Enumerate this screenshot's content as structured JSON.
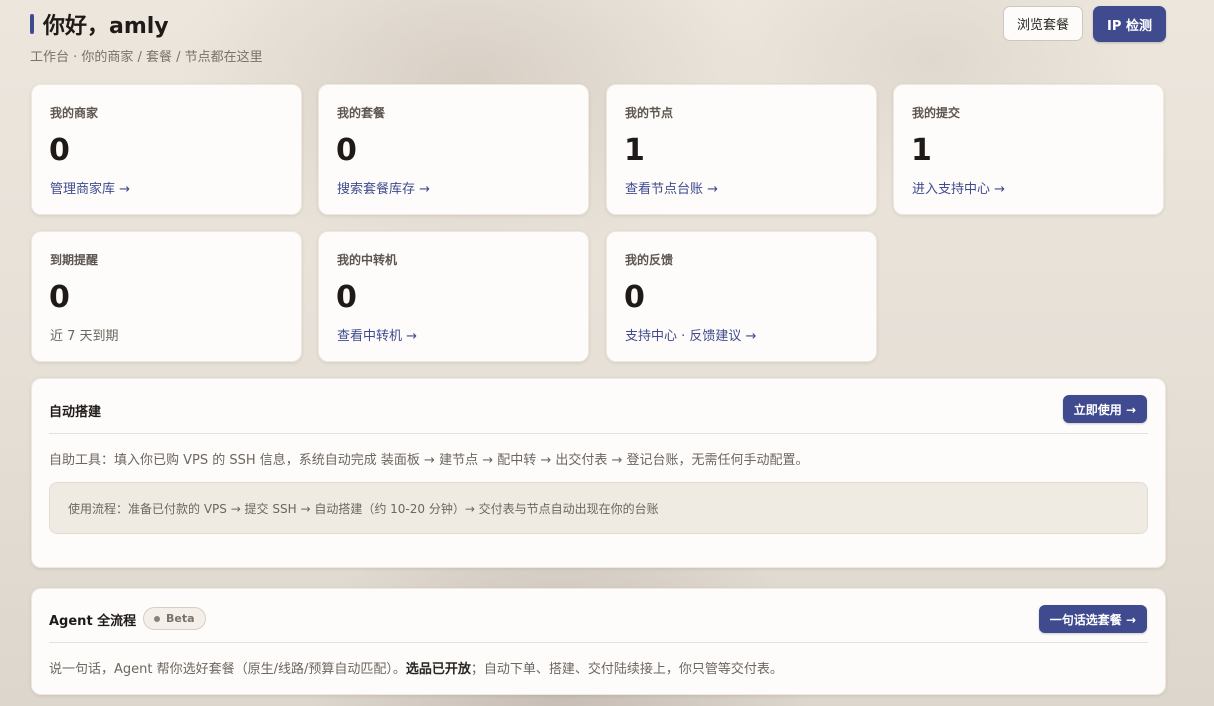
{
  "header": {
    "title": "你好，amly",
    "subtitle": "工作台 · 你的商家 / 套餐 / 节点都在这里",
    "browse_plans_label": "浏览套餐",
    "ip_check_label": "IP 检测"
  },
  "stats": [
    {
      "label": "我的商家",
      "value": "0",
      "link": "管理商家库 →"
    },
    {
      "label": "我的套餐",
      "value": "0",
      "link": "搜索套餐库存 →"
    },
    {
      "label": "我的节点",
      "value": "1",
      "link": "查看节点台账 →"
    },
    {
      "label": "我的提交",
      "value": "1",
      "link": "进入支持中心 →"
    },
    {
      "label": "到期提醒",
      "value": "0",
      "note": "近 7 天到期"
    },
    {
      "label": "我的中转机",
      "value": "0",
      "link": "查看中转机 →"
    },
    {
      "label": "我的反馈",
      "value": "0",
      "link": "支持中心 · 反馈建议 →"
    }
  ],
  "auto_build": {
    "title": "自动搭建",
    "button_label": "立即使用 →",
    "description": "自助工具：填入你已购 VPS 的 SSH 信息，系统自动完成 装面板 → 建节点 → 配中转 → 出交付表 → 登记台账，无需任何手动配置。",
    "flow": "使用流程：准备已付款的 VPS → 提交 SSH → 自动搭建（约 10-20 分钟）→ 交付表与节点自动出现在你的台账"
  },
  "agent": {
    "title": "Agent 全流程",
    "badge": "Beta",
    "button_label": "一句话选套餐 →",
    "desc_part1": "说一句话，Agent 帮你选好套餐（原生/线路/预算自动匹配）。",
    "desc_bold": "选品已开放",
    "desc_part2": "；自动下单、搭建、交付陆续接上，你只管等交付表。"
  },
  "colors": {
    "accent": "#3f4a8f",
    "card_bg": "#fdfcfa"
  }
}
